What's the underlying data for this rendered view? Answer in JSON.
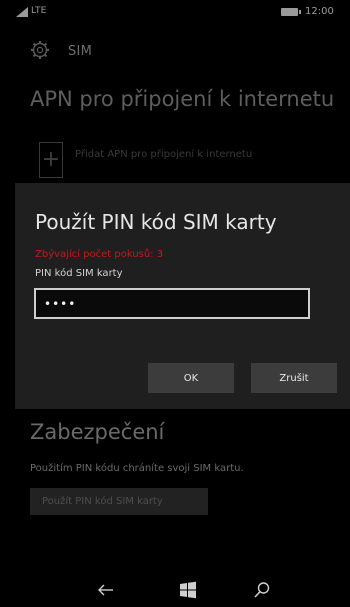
{
  "status_bar": {
    "network": "LTE",
    "time": "12:00",
    "signal_icon": "signal-strength-icon",
    "battery_icon": "battery-icon"
  },
  "header": {
    "icon": "gear-icon",
    "title": "SIM"
  },
  "apn_section": {
    "heading": "APN pro připojení k internetu",
    "add_icon": "plus-icon",
    "add_label": "Přidat APN pro připojení k internetu"
  },
  "dialog": {
    "title": "Použít PIN kód SIM karty",
    "attempts_text": "Zbývající počet pokusů: 3",
    "pin_label": "PIN kód SIM karty",
    "pin_value": "••••",
    "ok_label": "OK",
    "cancel_label": "Zrušit"
  },
  "security_section": {
    "heading": "Zabezpečení",
    "description": "Použitím PIN kódu chráníte svoji SIM kartu.",
    "button_label": "Použít PIN kód SIM karty"
  },
  "nav_bar": {
    "back_icon": "back-arrow-icon",
    "home_icon": "windows-start-icon",
    "search_icon": "search-icon"
  },
  "colors": {
    "background": "#000000",
    "dialog_background": "#1f1f1f",
    "error_text": "#c21a1a",
    "button_background": "#3c3c3c"
  }
}
